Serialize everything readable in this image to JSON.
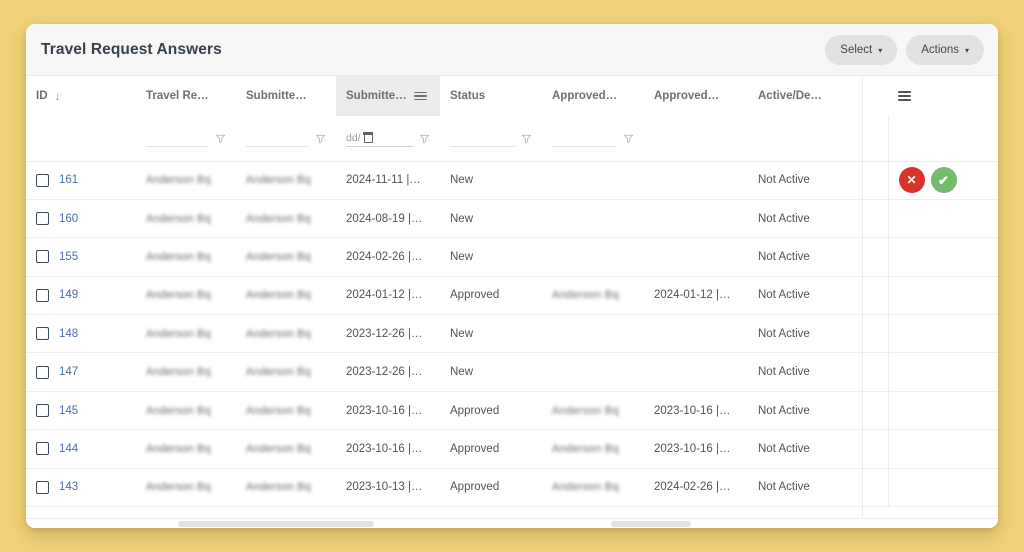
{
  "window": {
    "background_color": "#f2d279",
    "card_background": "#ffffff"
  },
  "header": {
    "title": "Travel Request Answers",
    "select_button": "Select",
    "actions_button": "Actions",
    "caret_glyph": "▾"
  },
  "grid": {
    "columns": [
      {
        "key": "id",
        "label": "ID",
        "sorted": true,
        "sort_glyph": "↓",
        "has_menu": false,
        "highlighted": false,
        "has_filter": false
      },
      {
        "key": "travel",
        "label": "Travel Re…",
        "has_menu": false,
        "highlighted": false,
        "has_filter": true
      },
      {
        "key": "subby",
        "label": "Submitte…",
        "has_menu": false,
        "highlighted": false,
        "has_filter": true
      },
      {
        "key": "subon",
        "label": "Submitte…",
        "has_menu": true,
        "highlighted": true,
        "has_filter": true
      },
      {
        "key": "status",
        "label": "Status",
        "has_menu": false,
        "highlighted": false,
        "has_filter": true
      },
      {
        "key": "appby",
        "label": "Approved…",
        "has_menu": false,
        "highlighted": false,
        "has_filter": true
      },
      {
        "key": "appon",
        "label": "Approved…",
        "has_menu": false,
        "highlighted": false,
        "has_filter": false
      },
      {
        "key": "active",
        "label": "Active/De…",
        "has_menu": false,
        "highlighted": false,
        "has_filter": false
      },
      {
        "key": "spacer",
        "label": "",
        "has_menu": false,
        "highlighted": false,
        "has_filter": false
      },
      {
        "key": "actions",
        "label": "",
        "has_menu": true,
        "highlighted": false,
        "has_filter": false
      }
    ],
    "filters": {
      "date_placeholder": "dd/",
      "calendar_icon": "calendar-icon",
      "funnel_icon": "filter-funnel-icon"
    },
    "rows": [
      {
        "id": "161",
        "travel_request": "redacted",
        "submitted_by": "redacted",
        "submitted_on": "2024-11-11 |…",
        "status": "New",
        "approved_by": "",
        "approved_on": "",
        "active": "Not Active",
        "show_actions": true
      },
      {
        "id": "160",
        "travel_request": "redacted",
        "submitted_by": "redacted",
        "submitted_on": "2024-08-19 |…",
        "status": "New",
        "approved_by": "",
        "approved_on": "",
        "active": "Not Active",
        "show_actions": false
      },
      {
        "id": "155",
        "travel_request": "redacted",
        "submitted_by": "redacted",
        "submitted_on": "2024-02-26 |…",
        "status": "New",
        "approved_by": "",
        "approved_on": "",
        "active": "Not Active",
        "show_actions": false
      },
      {
        "id": "149",
        "travel_request": "redacted",
        "submitted_by": "redacted",
        "submitted_on": "2024-01-12 |…",
        "status": "Approved",
        "approved_by": "redacted",
        "approved_on": "2024-01-12 |…",
        "active": "Not Active",
        "show_actions": false
      },
      {
        "id": "148",
        "travel_request": "redacted",
        "submitted_by": "redacted",
        "submitted_on": "2023-12-26 |…",
        "status": "New",
        "approved_by": "",
        "approved_on": "",
        "active": "Not Active",
        "show_actions": false
      },
      {
        "id": "147",
        "travel_request": "redacted",
        "submitted_by": "redacted",
        "submitted_on": "2023-12-26 |…",
        "status": "New",
        "approved_by": "",
        "approved_on": "",
        "active": "Not Active",
        "show_actions": false
      },
      {
        "id": "145",
        "travel_request": "redacted",
        "submitted_by": "redacted",
        "submitted_on": "2023-10-16 |…",
        "status": "Approved",
        "approved_by": "redacted",
        "approved_on": "2023-10-16 |…",
        "active": "Not Active",
        "show_actions": false
      },
      {
        "id": "144",
        "travel_request": "redacted",
        "submitted_by": "redacted",
        "submitted_on": "2023-10-16 |…",
        "status": "Approved",
        "approved_by": "redacted",
        "approved_on": "2023-10-16 |…",
        "active": "Not Active",
        "show_actions": false
      },
      {
        "id": "143",
        "travel_request": "redacted",
        "submitted_by": "redacted",
        "submitted_on": "2023-10-13 |…",
        "status": "Approved",
        "approved_by": "redacted",
        "approved_on": "2024-02-26 |…",
        "active": "Not Active",
        "show_actions": false
      }
    ],
    "redacted_placeholder": "Anderson Bq",
    "row_actions": {
      "reject_glyph": "✕",
      "approve_glyph": "✔",
      "reject_color": "#d9342b",
      "approve_color": "#74bb6d"
    }
  }
}
